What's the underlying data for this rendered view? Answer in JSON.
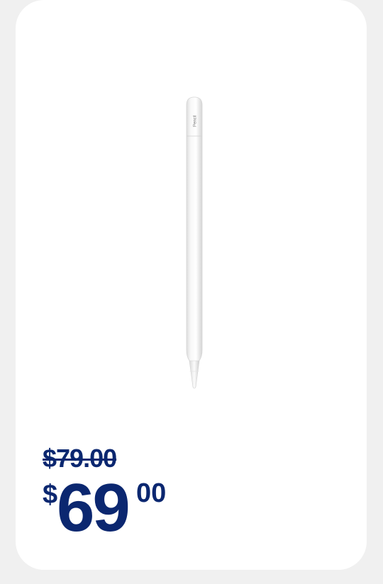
{
  "product": {
    "image_icon": "apple-pencil-image",
    "engraving": "Pencil"
  },
  "price": {
    "original": "$79.00",
    "currency_symbol": "$",
    "dollars": "69",
    "cents": "00",
    "color": "#0b2770"
  }
}
